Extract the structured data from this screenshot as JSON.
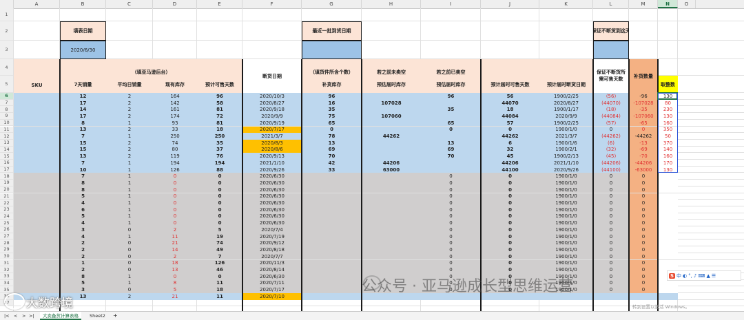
{
  "columns": [
    "A",
    "B",
    "C",
    "D",
    "E",
    "F",
    "G",
    "H",
    "I",
    "J",
    "K",
    "L",
    "M",
    "N",
    "O"
  ],
  "selected_column": "N",
  "selected_row": "6",
  "row_numbers": [
    "1",
    "2",
    "3",
    "4",
    "5",
    "6",
    "7",
    "8",
    "9",
    "10",
    "11",
    "12",
    "13",
    "14",
    "15",
    "16",
    "17",
    "18",
    "19",
    "20",
    "21",
    "22",
    "23",
    "24",
    "25",
    "26",
    "27",
    "28",
    "29",
    "30",
    "31",
    "32",
    "33",
    "34",
    "35",
    "36",
    "37"
  ],
  "labels": {
    "fill_date_label": "填表日期",
    "fill_date_value": "2020/6/30",
    "recent_arrival_label": "最近一批到货日期",
    "keep_stock_label": "保证不断货到这天",
    "sku": "SKU",
    "amazon_group": "（填亚马逊后台）",
    "sales_7d": "7天销量",
    "avg_daily_sales": "平均日销量",
    "current_stock": "现有库存",
    "est_days": "预计可售天数",
    "stockout_date": "断货日期",
    "piece_count_group": "（填货件所含个数）",
    "restock_inventory": "补货库存",
    "if_before_unsold": "若之前未卖空",
    "est_arrival_inventory": "预估届时库存",
    "if_before_sold": "若之前已卖空",
    "est_arrival_inventory2": "预估届时库存",
    "est_arrival_days": "预计届时可售天数",
    "est_arrival_stockout": "预计届时断货日期",
    "keep_days_needed": "保证不断货所需可售天数",
    "restock_qty": "补货数量",
    "rounded_qty": "取整数"
  },
  "rows": [
    {
      "b": "12",
      "c": "2",
      "d": "164",
      "e": "96",
      "f": "2020/10/3",
      "g": "96",
      "h": "",
      "i": "96",
      "j": "56",
      "k": "1900/2/25",
      "l": "(56)",
      "m": "-96",
      "n": "130"
    },
    {
      "b": "17",
      "c": "2",
      "d": "142",
      "e": "58",
      "f": "2020/8/27",
      "g": "16",
      "h": "107028",
      "i": "",
      "j": "44070",
      "k": "2020/8/27",
      "l": "(44070)",
      "m": "-107028",
      "n": "80"
    },
    {
      "b": "14",
      "c": "2",
      "d": "161",
      "e": "81",
      "f": "2020/9/18",
      "g": "35",
      "h": "",
      "i": "35",
      "j": "18",
      "k": "1900/1/17",
      "l": "(18)",
      "m": "-35",
      "n": "230"
    },
    {
      "b": "17",
      "c": "2",
      "d": "174",
      "e": "72",
      "f": "2020/9/9",
      "g": "75",
      "h": "107060",
      "i": "",
      "j": "44084",
      "k": "2020/9/9",
      "l": "(44084)",
      "m": "-107060",
      "n": "130"
    },
    {
      "b": "8",
      "c": "1",
      "d": "93",
      "e": "81",
      "f": "2020/9/19",
      "g": "65",
      "h": "",
      "i": "65",
      "j": "57",
      "k": "1900/2/25",
      "l": "(57)",
      "m": "-65",
      "n": "160"
    },
    {
      "b": "13",
      "c": "2",
      "d": "33",
      "e": "18",
      "f": "2020/7/17",
      "g": "0",
      "h": "",
      "i": "0",
      "j": "0",
      "k": "1900/1/0",
      "l": "0",
      "m": "0",
      "n": "350"
    },
    {
      "b": "7",
      "c": "1",
      "d": "250",
      "e": "250",
      "f": "2021/3/7",
      "g": "78",
      "h": "44262",
      "i": "",
      "j": "44262",
      "k": "2021/3/7",
      "l": "(44262)",
      "m": "-44262",
      "n": "50"
    },
    {
      "b": "15",
      "c": "2",
      "d": "74",
      "e": "35",
      "f": "2020/8/3",
      "g": "13",
      "h": "",
      "i": "13",
      "j": "6",
      "k": "1900/1/6",
      "l": "(6)",
      "m": "-13",
      "n": "370"
    },
    {
      "b": "15",
      "c": "2",
      "d": "80",
      "e": "37",
      "f": "2020/8/6",
      "g": "69",
      "h": "",
      "i": "69",
      "j": "32",
      "k": "1900/2/1",
      "l": "(32)",
      "m": "-69",
      "n": "140"
    },
    {
      "b": "13",
      "c": "2",
      "d": "119",
      "e": "76",
      "f": "2020/9/13",
      "g": "70",
      "h": "",
      "i": "70",
      "j": "45",
      "k": "1900/2/13",
      "l": "(45)",
      "m": "-70",
      "n": "160"
    },
    {
      "b": "7",
      "c": "1",
      "d": "194",
      "e": "194",
      "f": "2021/1/10",
      "g": "42",
      "h": "44206",
      "i": "",
      "j": "44206",
      "k": "2021/1/10",
      "l": "(44206)",
      "m": "-44206",
      "n": "170"
    },
    {
      "b": "10",
      "c": "1",
      "d": "126",
      "e": "88",
      "f": "2020/9/26",
      "g": "33",
      "h": "63000",
      "i": "",
      "j": "44100",
      "k": "2020/9/26",
      "l": "(44100)",
      "m": "-63000",
      "n": "130"
    },
    {
      "b": "7",
      "c": "1",
      "d": "0",
      "e": "0",
      "f": "2020/6/30",
      "g": "",
      "h": "",
      "i": "0",
      "j": "0",
      "k": "1900/1/0",
      "l": "0",
      "m": "0",
      "n": ""
    },
    {
      "b": "8",
      "c": "1",
      "d": "0",
      "e": "0",
      "f": "2020/6/30",
      "g": "",
      "h": "",
      "i": "0",
      "j": "0",
      "k": "1900/1/0",
      "l": "0",
      "m": "0",
      "n": ""
    },
    {
      "b": "8",
      "c": "1",
      "d": "0",
      "e": "0",
      "f": "2020/6/30",
      "g": "",
      "h": "",
      "i": "0",
      "j": "0",
      "k": "1900/1/0",
      "l": "0",
      "m": "0",
      "n": ""
    },
    {
      "b": "5",
      "c": "1",
      "d": "0",
      "e": "0",
      "f": "2020/6/30",
      "g": "",
      "h": "",
      "i": "0",
      "j": "0",
      "k": "1900/1/0",
      "l": "0",
      "m": "0",
      "n": ""
    },
    {
      "b": "4",
      "c": "1",
      "d": "0",
      "e": "0",
      "f": "2020/6/30",
      "g": "",
      "h": "",
      "i": "0",
      "j": "0",
      "k": "1900/1/0",
      "l": "0",
      "m": "0",
      "n": ""
    },
    {
      "b": "6",
      "c": "1",
      "d": "0",
      "e": "0",
      "f": "2020/6/30",
      "g": "",
      "h": "",
      "i": "0",
      "j": "0",
      "k": "1900/1/0",
      "l": "0",
      "m": "0",
      "n": ""
    },
    {
      "b": "5",
      "c": "1",
      "d": "0",
      "e": "0",
      "f": "2020/6/30",
      "g": "",
      "h": "",
      "i": "0",
      "j": "0",
      "k": "1900/1/0",
      "l": "0",
      "m": "0",
      "n": ""
    },
    {
      "b": "4",
      "c": "1",
      "d": "0",
      "e": "0",
      "f": "2020/6/30",
      "g": "",
      "h": "",
      "i": "0",
      "j": "0",
      "k": "1900/1/0",
      "l": "0",
      "m": "0",
      "n": ""
    },
    {
      "b": "3",
      "c": "0",
      "d": "2",
      "e": "5",
      "f": "2020/7/4",
      "g": "",
      "h": "",
      "i": "0",
      "j": "0",
      "k": "1900/1/0",
      "l": "0",
      "m": "0",
      "n": ""
    },
    {
      "b": "4",
      "c": "1",
      "d": "11",
      "e": "19",
      "f": "2020/7/19",
      "g": "",
      "h": "",
      "i": "0",
      "j": "0",
      "k": "1900/1/0",
      "l": "0",
      "m": "0",
      "n": ""
    },
    {
      "b": "2",
      "c": "0",
      "d": "21",
      "e": "74",
      "f": "2020/9/12",
      "g": "",
      "h": "",
      "i": "0",
      "j": "0",
      "k": "1900/1/0",
      "l": "0",
      "m": "0",
      "n": ""
    },
    {
      "b": "2",
      "c": "0",
      "d": "14",
      "e": "49",
      "f": "2020/8/18",
      "g": "",
      "h": "",
      "i": "0",
      "j": "0",
      "k": "1900/1/0",
      "l": "0",
      "m": "0",
      "n": ""
    },
    {
      "b": "2",
      "c": "0",
      "d": "2",
      "e": "7",
      "f": "2020/7/7",
      "g": "",
      "h": "",
      "i": "0",
      "j": "0",
      "k": "1900/1/0",
      "l": "0",
      "m": "0",
      "n": ""
    },
    {
      "b": "1",
      "c": "0",
      "d": "18",
      "e": "126",
      "f": "2020/11/3",
      "g": "",
      "h": "",
      "i": "0",
      "j": "0",
      "k": "1900/1/0",
      "l": "0",
      "m": "0",
      "n": ""
    },
    {
      "b": "2",
      "c": "0",
      "d": "13",
      "e": "46",
      "f": "2020/8/14",
      "g": "",
      "h": "",
      "i": "0",
      "j": "0",
      "k": "1900/1/0",
      "l": "0",
      "m": "0",
      "n": ""
    },
    {
      "b": "8",
      "c": "1",
      "d": "0",
      "e": "0",
      "f": "2020/6/30",
      "g": "",
      "h": "",
      "i": "0",
      "j": "0",
      "k": "1900/1/0",
      "l": "0",
      "m": "0",
      "n": ""
    },
    {
      "b": "5",
      "c": "1",
      "d": "8",
      "e": "11",
      "f": "2020/7/11",
      "g": "",
      "h": "",
      "i": "0",
      "j": "0",
      "k": "1900/1/0",
      "l": "0",
      "m": "0",
      "n": ""
    },
    {
      "b": "3",
      "c": "0",
      "d": "5",
      "e": "18",
      "f": "2020/7/17",
      "g": "",
      "h": "",
      "i": "0",
      "j": "0",
      "k": "1900/1/0",
      "l": "0",
      "m": "0",
      "n": ""
    },
    {
      "b": "13",
      "c": "2",
      "d": "21",
      "e": "11",
      "f": "2020/7/10",
      "g": "",
      "h": "",
      "i": "",
      "j": "",
      "k": "",
      "l": "",
      "m": "",
      "n": ""
    }
  ],
  "orange_stockout_rows": [
    5,
    7,
    8,
    30
  ],
  "bold_i_rows": [
    0,
    1,
    2,
    3,
    4,
    5,
    6,
    7,
    8,
    9,
    10,
    11
  ],
  "tabs": [
    "大卖备货计算表格",
    "Sheet2"
  ],
  "add_tab": "+",
  "watermark_main": "公众号 · 亚马逊成长型思维运营",
  "watermark_logo": "大数跨境",
  "ime_label": "S",
  "ime_lang": "中",
  "activate_windows": "转到设置以激活 Windows。",
  "colors": {
    "blue": "#bdd7ee",
    "grey": "#d0cece",
    "peach": "#fce4d6",
    "orange_m": "#f4b183",
    "orange_stockout": "#ffc000",
    "yellow_n": "#ffff00",
    "date_blue": "#9dc3e6"
  }
}
